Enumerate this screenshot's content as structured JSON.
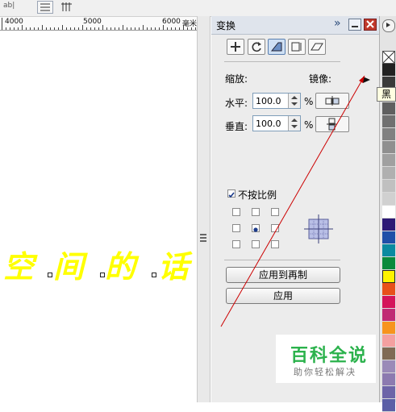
{
  "toolbar": {
    "left_text": "ab|",
    "btn1_icon": "align-lines-icon",
    "btn2_icon": "vertical-bars-icon"
  },
  "ruler": {
    "labels": [
      "4000",
      "5000",
      "6000"
    ],
    "unit": "毫米"
  },
  "canvas": {
    "text_glyphs": [
      "空",
      "间",
      "的",
      "话"
    ],
    "text_color": "#ffff00"
  },
  "docker": {
    "title": "变换",
    "tabs": [
      {
        "icon": "position-icon",
        "active": false
      },
      {
        "icon": "rotate-icon",
        "active": false
      },
      {
        "icon": "scale-mirror-icon",
        "active": true
      },
      {
        "icon": "size-icon",
        "active": false
      },
      {
        "icon": "skew-icon",
        "active": false
      }
    ],
    "scale_label": "缩放:",
    "mirror_label": "镜像:",
    "horizontal_label": "水平:",
    "horizontal_value": "100.0",
    "vertical_label": "垂直:",
    "vertical_value": "100.0",
    "percent": "%",
    "proportional_label": "不按比例",
    "proportional_checked": true,
    "anchor_selected": "center",
    "apply_copy_label": "应用到再制",
    "apply_label": "应用"
  },
  "palette": {
    "tooltip": "黑",
    "swatches": [
      "none",
      "#222222",
      "#3a3a3a",
      "#4d4d4d",
      "#5f5f5f",
      "#707070",
      "#808080",
      "#8f8f8f",
      "#a0a0a0",
      "#b0b0b0",
      "#c0c0c0",
      "#d0d0d0",
      "#ffffff",
      "#2d1a75",
      "#1f4fa8",
      "#0a8aa0",
      "#0a8a3c",
      "#fff200",
      "#e8501a",
      "#d4145a",
      "#c02a74",
      "#f7941d",
      "#f4a0a0",
      "#7f6a54",
      "#9a8ab8",
      "#8c7ab0",
      "#6d64a8",
      "#5b5fa6"
    ]
  },
  "watermark": {
    "title": "百科全说",
    "subtitle": "助你轻松解决"
  },
  "accent_colors": {
    "arrow": "#cc0000",
    "title_bg": "#dfe4ec",
    "close_btn": "#c0392b"
  }
}
